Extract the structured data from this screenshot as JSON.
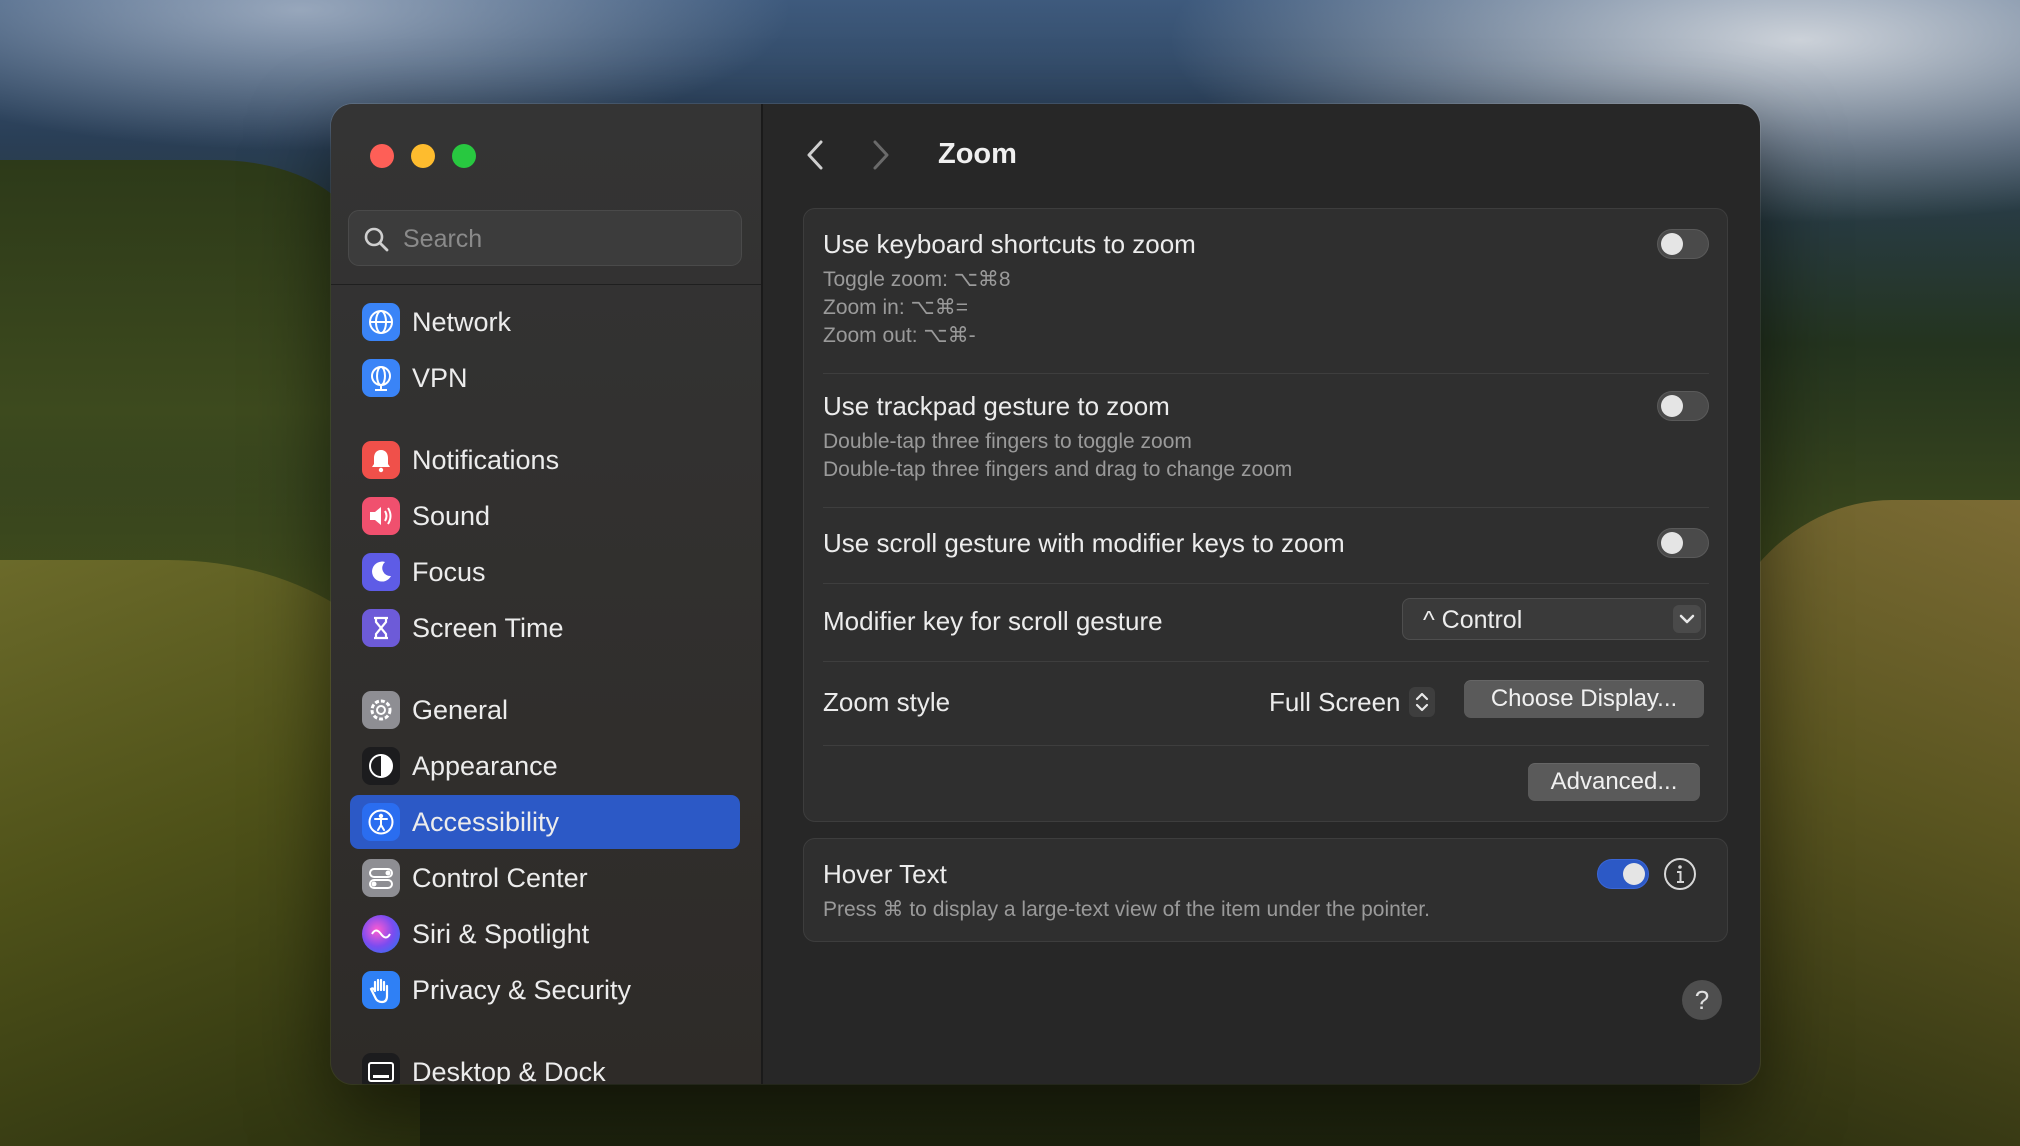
{
  "window": {
    "title": "Zoom",
    "nav_back_label": "Back",
    "nav_forward_label": "Forward"
  },
  "search": {
    "placeholder": "Search"
  },
  "sidebar": {
    "items": [
      {
        "label": "Network",
        "icon": "globe-icon",
        "color": "#3a84f7"
      },
      {
        "label": "VPN",
        "icon": "vpn-globe-icon",
        "color": "#3a84f7"
      },
      {
        "label": "Notifications",
        "icon": "bell-icon",
        "color": "#f0504a"
      },
      {
        "label": "Sound",
        "icon": "speaker-icon",
        "color": "#f0506e"
      },
      {
        "label": "Focus",
        "icon": "moon-icon",
        "color": "#5e5ce6"
      },
      {
        "label": "Screen Time",
        "icon": "hourglass-icon",
        "color": "#6d5bd8"
      },
      {
        "label": "General",
        "icon": "gear-icon",
        "color": "#8e8e93"
      },
      {
        "label": "Appearance",
        "icon": "appearance-icon",
        "color": "#1c1c1e"
      },
      {
        "label": "Accessibility",
        "icon": "accessibility-icon",
        "color": "#2a6df0"
      },
      {
        "label": "Control Center",
        "icon": "control-center-icon",
        "color": "#8e8e93"
      },
      {
        "label": "Siri & Spotlight",
        "icon": "siri-icon",
        "color": "#a24cf0"
      },
      {
        "label": "Privacy & Security",
        "icon": "hand-icon",
        "color": "#2f80f5"
      },
      {
        "label": "Desktop & Dock",
        "icon": "dock-icon",
        "color": "#1c1c1e"
      }
    ],
    "active": "Accessibility"
  },
  "zoom_group": {
    "keyboard": {
      "title": "Use keyboard shortcuts to zoom",
      "lines": [
        "Toggle zoom: ⌥⌘8",
        "Zoom in: ⌥⌘=",
        "Zoom out: ⌥⌘-"
      ],
      "enabled": false
    },
    "trackpad": {
      "title": "Use trackpad gesture to zoom",
      "lines": [
        "Double-tap three fingers to toggle zoom",
        "Double-tap three fingers and drag to change zoom"
      ],
      "enabled": false
    },
    "scroll": {
      "title": "Use scroll gesture with modifier keys to zoom",
      "enabled": false
    },
    "modifier": {
      "title": "Modifier key for scroll gesture",
      "value": "^ Control"
    },
    "style": {
      "title": "Zoom style",
      "value": "Full Screen",
      "choose_label": "Choose Display..."
    },
    "advanced_label": "Advanced..."
  },
  "hover_group": {
    "title": "Hover Text",
    "subtitle": "Press ⌘ to display a large-text view of the item under the pointer.",
    "enabled": true
  },
  "help_label": "?"
}
